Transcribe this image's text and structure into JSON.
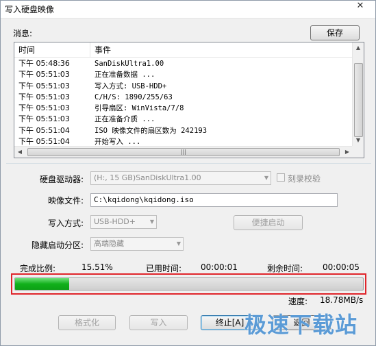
{
  "window": {
    "title": "写入硬盘映像",
    "close_glyph": "✕"
  },
  "messages": {
    "label": "消息:",
    "save_button": "保存"
  },
  "log": {
    "columns": [
      "时间",
      "事件"
    ],
    "rows": [
      {
        "time": "下午 05:48:36",
        "event": "SanDiskUltra1.00"
      },
      {
        "time": "下午 05:51:03",
        "event": "正在准备数据 ..."
      },
      {
        "time": "下午 05:51:03",
        "event": "写入方式: USB-HDD+"
      },
      {
        "time": "下午 05:51:03",
        "event": "C/H/S: 1890/255/63"
      },
      {
        "time": "下午 05:51:03",
        "event": "引导扇区: WinVista/7/8"
      },
      {
        "time": "下午 05:51:03",
        "event": "正在准备介质 ..."
      },
      {
        "time": "下午 05:51:04",
        "event": "ISO 映像文件的扇区数为 242193"
      },
      {
        "time": "下午 05:51:04",
        "event": "开始写入 ..."
      }
    ]
  },
  "form": {
    "drive_label": "硬盘驱动器:",
    "drive_value": "(H:, 15 GB)SanDiskUltra1.00",
    "verify_label": "刻录校验",
    "image_label": "映像文件:",
    "image_value": "C:\\kqidong\\kqidong.iso",
    "write_mode_label": "写入方式:",
    "write_mode_value": "USB-HDD+",
    "quick_boot_button": "便捷启动",
    "hidden_partition_label": "隐藏启动分区:",
    "hidden_partition_value": "高端隐藏"
  },
  "status": {
    "completion_label": "完成比例:",
    "completion_value": "15.51%",
    "progress_fraction": 0.1551,
    "elapsed_label": "已用时间:",
    "elapsed_value": "00:00:01",
    "remaining_label": "剩余时间:",
    "remaining_value": "00:00:05",
    "speed_label": "速度:",
    "speed_value": "18.78MB/s"
  },
  "buttons": {
    "format": "格式化",
    "write": "写入",
    "abort": "终止[A]",
    "back": "返回"
  },
  "watermark": {
    "text": "极速下载站"
  },
  "colors": {
    "highlight": "#e0242a",
    "progress": "#11b01a"
  }
}
